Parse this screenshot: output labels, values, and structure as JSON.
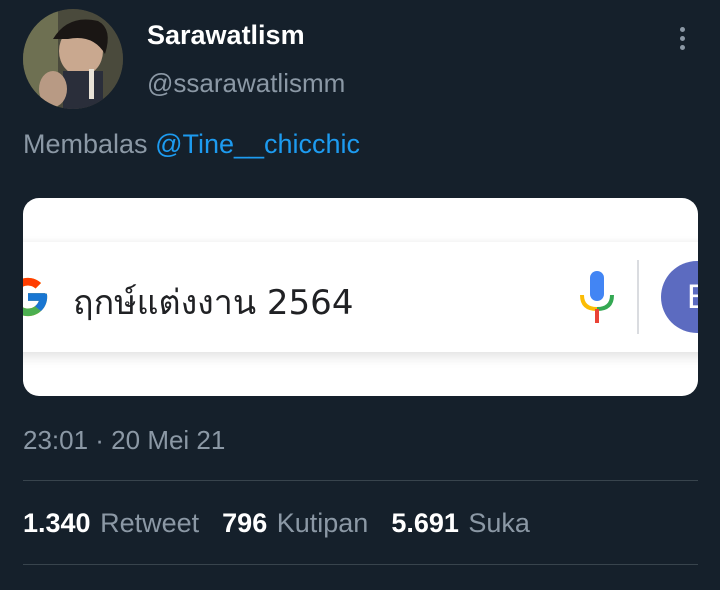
{
  "tweet": {
    "author": {
      "display_name": "Sarawatlism",
      "handle": "@ssarawatlismm"
    },
    "reply_to": {
      "label": "Membalas",
      "mention": "@Tine__chicchic"
    },
    "media": {
      "search_query": "ฤกษ์แต่งงาน 2564",
      "account_initial": "E"
    },
    "timestamp": "23:01 · 20 Mei 21",
    "stats": {
      "retweets": {
        "count": "1.340",
        "label": "Retweet"
      },
      "quotes": {
        "count": "796",
        "label": "Kutipan"
      },
      "likes": {
        "count": "5.691",
        "label": "Suka"
      }
    }
  },
  "colors": {
    "background": "#15202b",
    "secondary_text": "#8b98a5",
    "link": "#1d9bf0",
    "divider": "#38444d"
  },
  "icons": [
    "profile-avatar",
    "more-options-icon",
    "google-g-icon",
    "microphone-icon",
    "account-avatar"
  ]
}
